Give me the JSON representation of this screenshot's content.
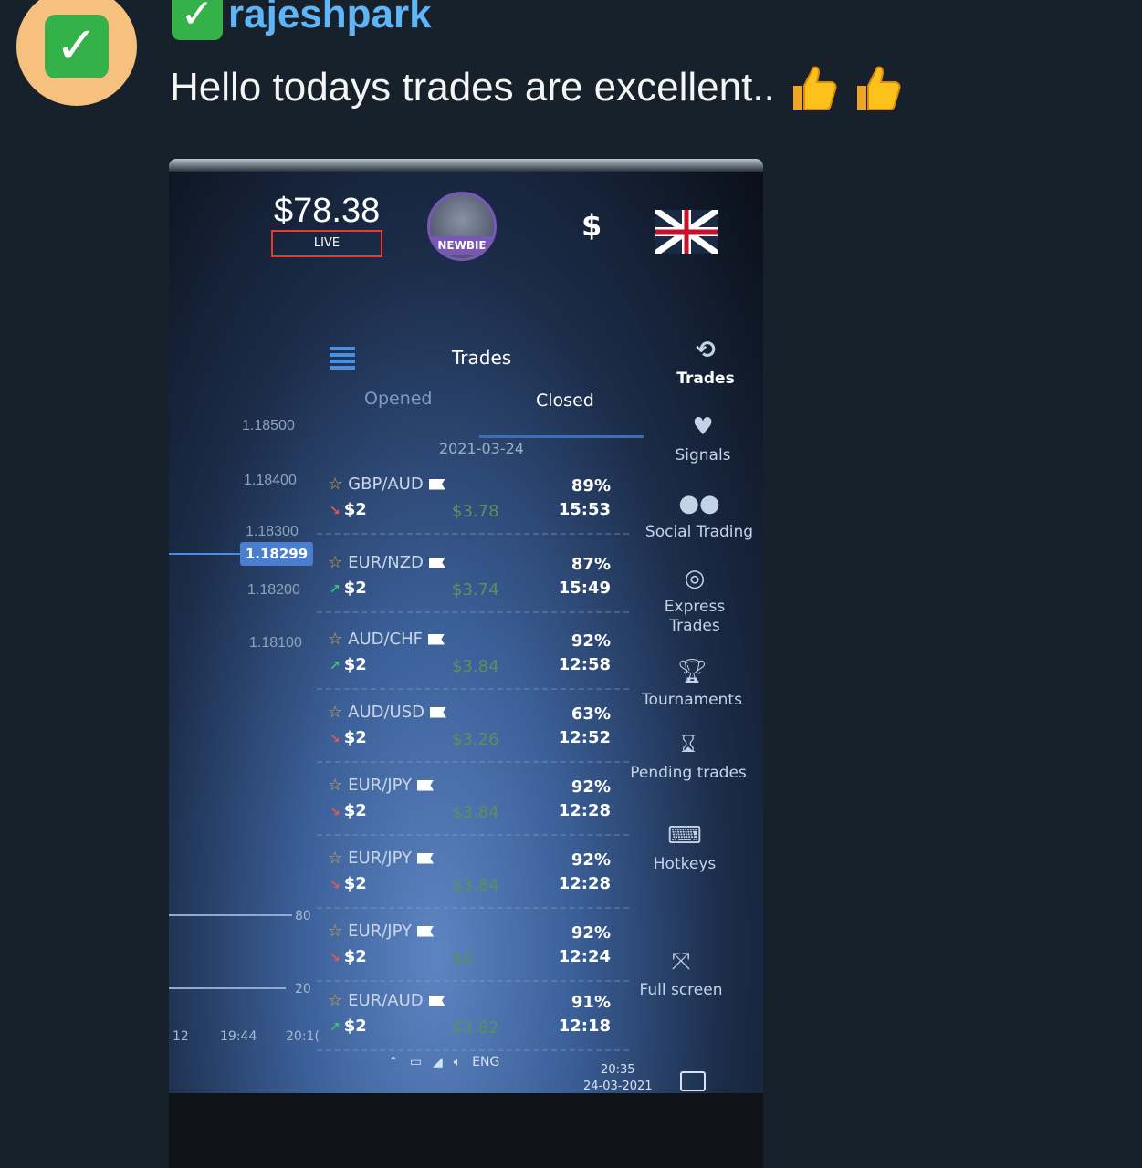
{
  "message": {
    "username": "rajeshpark",
    "text": "Hello todays trades are excellent..",
    "avatar_icon": "check-mark-icon",
    "emojis": [
      "thumbs-up-icon",
      "thumbs-up-icon"
    ]
  },
  "screenshot": {
    "balance": "$78.38",
    "account_type": "LIVE",
    "level_badge": "NEWBIE",
    "currency_symbol": "$",
    "flag_icon": "uk-flag-icon",
    "price_axis": [
      "1.18500",
      "1.18400",
      "1.18300",
      "1.18200",
      "1.18100"
    ],
    "current_price": "1.18299",
    "indicator_axis": [
      "80",
      "20"
    ],
    "time_axis": [
      "12",
      "19:44",
      "20:1("
    ],
    "panel": {
      "title": "Trades",
      "tabs": [
        "Opened",
        "Closed"
      ],
      "active_tab": "Closed",
      "date": "2021-03-24"
    },
    "trades": [
      {
        "pair": "GBP/AUD",
        "direction": "down",
        "amount": "$2",
        "payout": "$3.78",
        "percent": "89%",
        "time": "15:53"
      },
      {
        "pair": "EUR/NZD",
        "direction": "up",
        "amount": "$2",
        "payout": "$3.74",
        "percent": "87%",
        "time": "15:49"
      },
      {
        "pair": "AUD/CHF",
        "direction": "up",
        "amount": "$2",
        "payout": "$3.84",
        "percent": "92%",
        "time": "12:58"
      },
      {
        "pair": "AUD/USD",
        "direction": "down",
        "amount": "$2",
        "payout": "$3.26",
        "percent": "63%",
        "time": "12:52"
      },
      {
        "pair": "EUR/JPY",
        "direction": "down",
        "amount": "$2",
        "payout": "$3.84",
        "percent": "92%",
        "time": "12:28"
      },
      {
        "pair": "EUR/JPY",
        "direction": "down",
        "amount": "$2",
        "payout": "$3.84",
        "percent": "92%",
        "time": "12:28"
      },
      {
        "pair": "EUR/JPY",
        "direction": "down",
        "amount": "$2",
        "payout": "$0",
        "percent": "92%",
        "time": "12:24"
      },
      {
        "pair": "EUR/AUD",
        "direction": "up",
        "amount": "$2",
        "payout": "$3.82",
        "percent": "91%",
        "time": "12:18"
      }
    ],
    "sidebar": [
      {
        "label": "Trades",
        "icon": "history-icon"
      },
      {
        "label": "Signals",
        "icon": "heartbeat-icon"
      },
      {
        "label": "Social Trading",
        "icon": "users-icon"
      },
      {
        "label": "Express Trades",
        "icon": "target-icon"
      },
      {
        "label": "Tournaments",
        "icon": "trophy-icon"
      },
      {
        "label": "Pending trades",
        "icon": "hourglass-icon"
      },
      {
        "label": "Hotkeys",
        "icon": "keyboard-icon"
      },
      {
        "label": "Full screen",
        "icon": "fullscreen-icon"
      }
    ],
    "taskbar": {
      "language": "ENG",
      "time": "20:35",
      "date": "24-03-2021"
    }
  }
}
